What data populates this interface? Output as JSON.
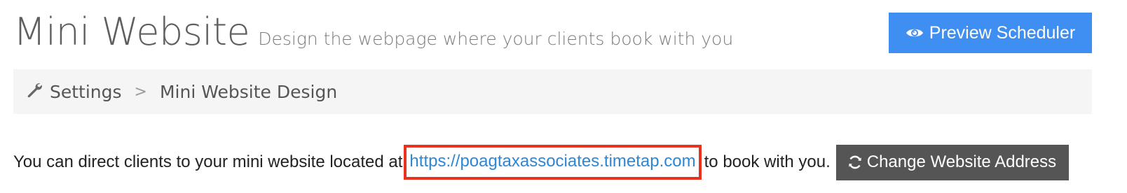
{
  "header": {
    "title": "Mini Website",
    "subtitle": "Design the webpage where your clients book with you",
    "preview_button_label": "Preview Scheduler",
    "preview_button_icon": "eye-icon"
  },
  "breadcrumb": {
    "icon": "wrench-icon",
    "items": [
      {
        "label": "Settings"
      },
      {
        "label": "Mini Website Design"
      }
    ],
    "separator": ">"
  },
  "info": {
    "text_before": "You can direct clients to your mini website located at",
    "url": "https://poagtaxassociates.timetap.com",
    "text_after": "to book with you.",
    "change_button_label": "Change Website Address",
    "change_button_icon": "refresh-icon"
  },
  "colors": {
    "primary_button": "#3f8ff2",
    "secondary_button": "#555555",
    "link": "#2f86d2",
    "highlight_border": "#e8321e",
    "breadcrumb_bg": "#f5f5f5"
  }
}
